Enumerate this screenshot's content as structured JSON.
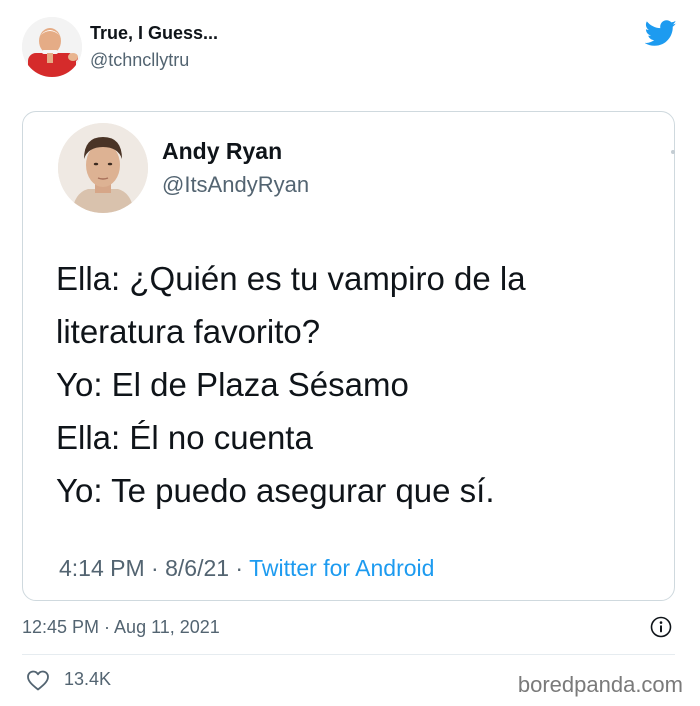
{
  "outer_tweet": {
    "display_name": "True, I Guess...",
    "handle": "@tchncllytru",
    "timestamp": "12:45 PM · Aug 11, 2021",
    "likes": "13.4K",
    "avatar_icon": "person-avatar",
    "brand_icon": "twitter-bird-icon",
    "info_icon": "info-icon",
    "like_icon": "heart-icon"
  },
  "quoted_tweet": {
    "display_name": "Andy Ryan",
    "handle": "@ItsAndyRyan",
    "lines": [
      "Ella: ¿Quién es tu vampiro de la",
      "literatura favorito?",
      "Yo: El de Plaza Sésamo",
      "Ella: Él no cuenta",
      "Yo: Te puedo asegurar que sí."
    ],
    "time_date": "4:14 PM · 8/6/21 · ",
    "source": "Twitter for Android"
  },
  "watermark": "boredpanda.com",
  "colors": {
    "twitter_blue": "#1d9bf0",
    "text_primary": "#0f1419",
    "text_secondary": "#536471",
    "border": "#cfd9de"
  }
}
